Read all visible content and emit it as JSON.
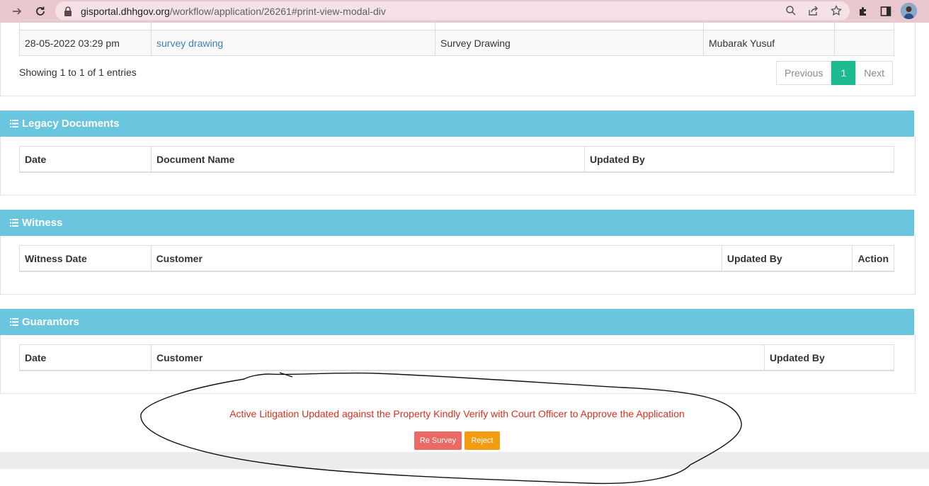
{
  "browser": {
    "url_host": "gisportal.dhhgov.org",
    "url_path": "/workflow/application/26261#print-view-modal-div"
  },
  "top_table": {
    "row": {
      "date": "28-05-2022 03:29 pm",
      "document_link": "survey drawing",
      "document_type": "Survey Drawing",
      "updated_by": "Mubarak Yusuf",
      "extra": ""
    },
    "info": "Showing 1 to 1 of 1 entries",
    "pagination": {
      "previous": "Previous",
      "current": "1",
      "next": "Next"
    }
  },
  "legacy_documents": {
    "title": "Legacy Documents",
    "columns": [
      "Date",
      "Document Name",
      "Updated By"
    ]
  },
  "witness": {
    "title": "Witness",
    "columns": [
      "Witness Date",
      "Customer",
      "Updated By",
      "Action"
    ]
  },
  "guarantors": {
    "title": "Guarantors",
    "columns": [
      "Date",
      "Customer",
      "Updated By"
    ]
  },
  "footer": {
    "warning": "Active Litigation Updated against the Property Kindly Verify with Court Officer to Approve the Application",
    "resurvey_label": "Re Survey",
    "reject_label": "Reject"
  },
  "colors": {
    "panel_heading": "#6ac5df",
    "pagination_active": "#1dbb8f",
    "warning_text": "#d9301e",
    "resurvey_button": "#ea6a66",
    "reject_button": "#f39c12",
    "chrome_bar": "#e9c7cf"
  }
}
